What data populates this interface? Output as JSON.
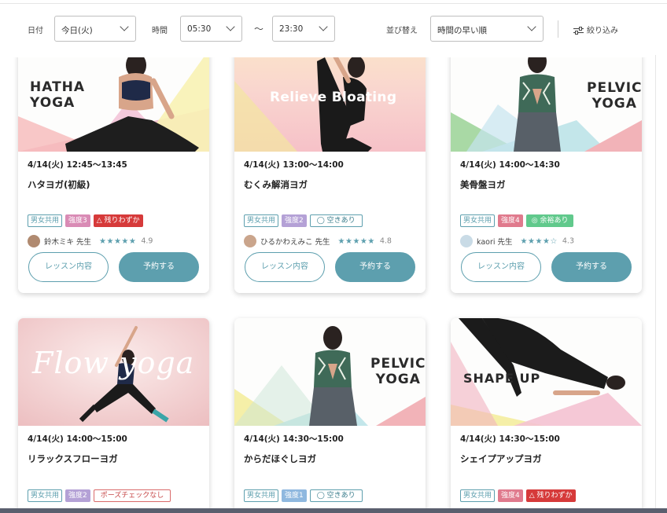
{
  "filters": {
    "date_label": "日付",
    "date_value": "今日(火)",
    "time_label": "時間",
    "time_from": "05:30",
    "time_sep": "〜",
    "time_to": "23:30",
    "sort_label": "並び替え",
    "sort_value": "時間の早い順",
    "filter_label": "絞り込み"
  },
  "colors": {
    "accent": "#5d9fae",
    "level2": "#b4a1d6",
    "level3": "#d98bb5",
    "level1": "#8fb8df",
    "level4": "#e07a8d",
    "few": "#d63a3a",
    "plenty": "#61c98c"
  },
  "cards": [
    {
      "thumb_title": "HATHA\nYOGA",
      "time": "4/14(火) 12:45〜13:45",
      "name": "ハタヨガ(初級)",
      "gender": "男女共用",
      "level": "強度3",
      "availability": "△ 残りわずか",
      "teacher": "鈴木ミキ 先生",
      "stars": "★★★★★",
      "rating": "4.9",
      "detail_label": "レッスン内容",
      "reserve_label": "予約する"
    },
    {
      "thumb_title": "Relieve Bloating",
      "time": "4/14(火) 13:00〜14:00",
      "name": "むくみ解消ヨガ",
      "gender": "男女共用",
      "level": "強度2",
      "availability": "◯ 空きあり",
      "teacher": "ひるかわえみこ 先生",
      "stars": "★★★★★",
      "rating": "4.8",
      "detail_label": "レッスン内容",
      "reserve_label": "予約する"
    },
    {
      "thumb_title": "PELVIC\nYOGA",
      "time": "4/14(火) 14:00〜14:30",
      "name": "美骨盤ヨガ",
      "gender": "男女共用",
      "level": "強度4",
      "availability": "◎ 余裕あり",
      "teacher": "kaori 先生",
      "stars": "★★★★☆",
      "rating": "4.3",
      "detail_label": "レッスン内容",
      "reserve_label": "予約する"
    },
    {
      "thumb_title": "Flow yoga",
      "time": "4/14(火) 14:00〜15:00",
      "name": "リラックスフローヨガ",
      "gender": "男女共用",
      "level": "強度2",
      "availability": "ポーズチェックなし"
    },
    {
      "thumb_title": "PELVIC\nYOGA",
      "time": "4/14(火) 14:30〜15:00",
      "name": "からだほぐしヨガ",
      "gender": "男女共用",
      "level": "強度1",
      "availability": "◯ 空きあり"
    },
    {
      "thumb_title": "SHAPE UP",
      "time": "4/14(火) 14:30〜15:00",
      "name": "シェイプアップヨガ",
      "gender": "男女共用",
      "level": "強度4",
      "availability": "△ 残りわずか"
    }
  ]
}
